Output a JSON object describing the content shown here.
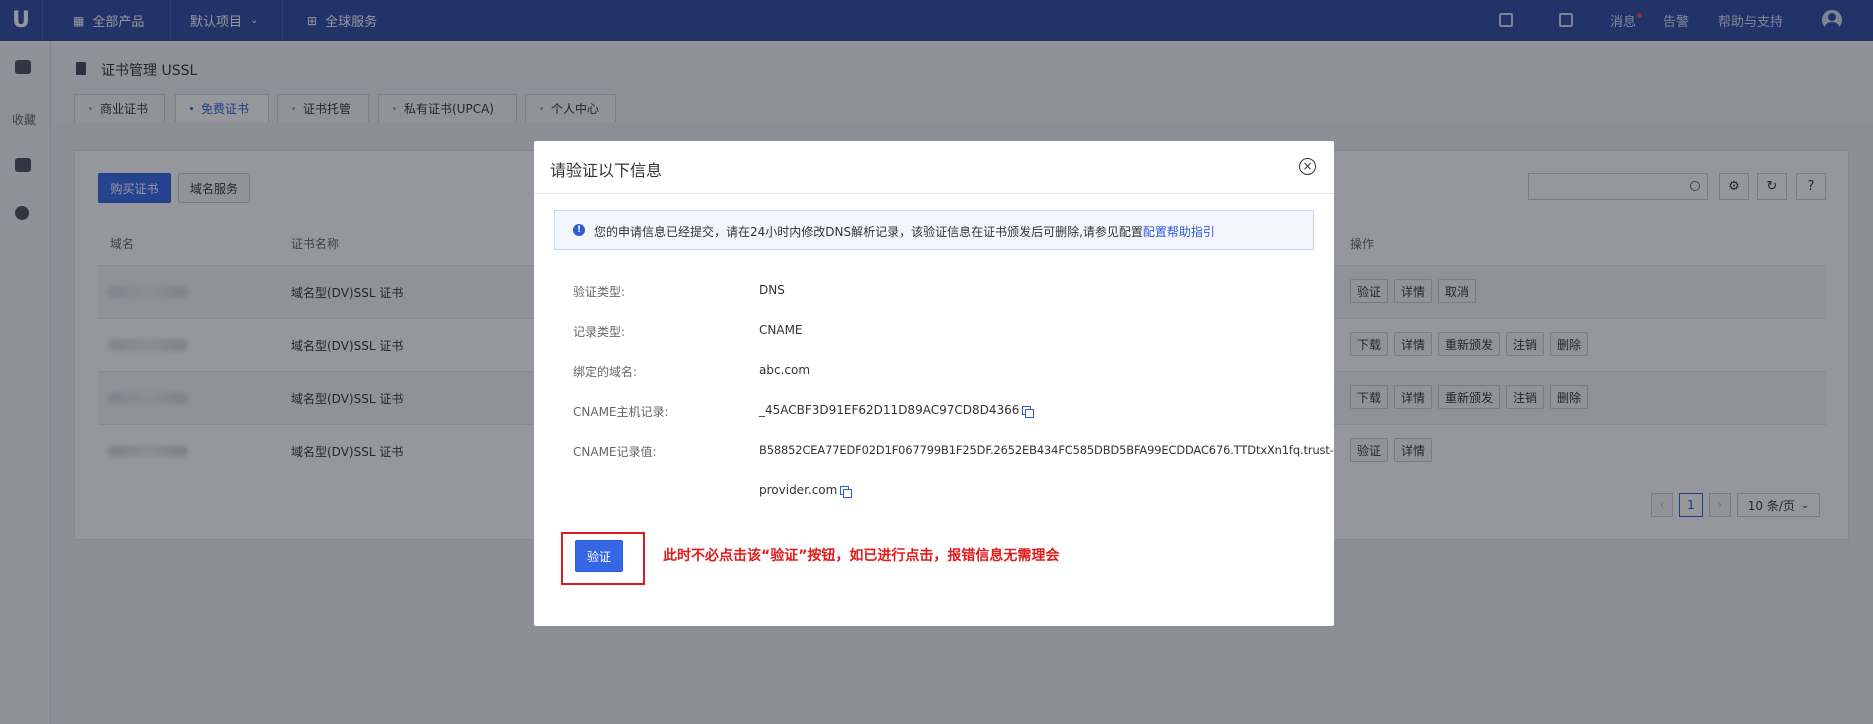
{
  "topbar": {
    "logo": "U",
    "nav": [
      "全部产品",
      "默认项目",
      "全球服务"
    ],
    "right": [
      "消息",
      "告警",
      "帮助与支持"
    ]
  },
  "sidebar": {
    "favorites_label": "收藏"
  },
  "page": {
    "title": "证书管理 USSL",
    "tabs": [
      "商业证书",
      "免费证书",
      "证书托管",
      "私有证书(UPCA)",
      "个人中心"
    ],
    "active_tab": "免费证书"
  },
  "toolbar": {
    "buy_label": "购买证书",
    "domain_service_label": "域名服务"
  },
  "table": {
    "headers": [
      "域名",
      "证书名称",
      "操作"
    ],
    "rows": [
      {
        "cert_name": "域名型(DV)SSL 证书",
        "actions": [
          "验证",
          "详情",
          "取消"
        ]
      },
      {
        "cert_name": "域名型(DV)SSL 证书",
        "actions": [
          "下载",
          "详情",
          "重新颁发",
          "注销",
          "删除"
        ]
      },
      {
        "cert_name": "域名型(DV)SSL 证书",
        "actions": [
          "下载",
          "详情",
          "重新颁发",
          "注销",
          "删除"
        ]
      },
      {
        "cert_name": "域名型(DV)SSL 证书",
        "actions": [
          "验证",
          "详情"
        ]
      }
    ]
  },
  "pagination": {
    "current": "1",
    "page_size": "10 条/页"
  },
  "modal": {
    "title": "请验证以下信息",
    "notice": "您的申请信息已经提交，请在24小时内修改DNS解析记录，该验证信息在证书颁发后可删除,请参见配置",
    "notice_link": "配置帮助指引",
    "fields": [
      {
        "label": "验证类型:",
        "value": "DNS"
      },
      {
        "label": "记录类型:",
        "value": "CNAME"
      },
      {
        "label": "绑定的域名:",
        "value": "abc.com"
      },
      {
        "label": "CNAME主机记录:",
        "value": "_45ACBF3D91EF62D11D89AC97CD8D4366"
      },
      {
        "label": "CNAME记录值:",
        "value": "B58852CEA77EDF02D1F067799B1F25DF.2652EB434FC585DBD5BFA99ECDDAC676.TTDtxXn1fq.trust-",
        "value_line2": "provider.com"
      }
    ],
    "verify_label": "验证",
    "warning": "此时不必点击该“验证”按钮，如已进行点击，报错信息无需理会"
  },
  "colors": {
    "brand": "#2f4aa5",
    "primary": "#3466e5",
    "warning": "#e11b1b"
  }
}
